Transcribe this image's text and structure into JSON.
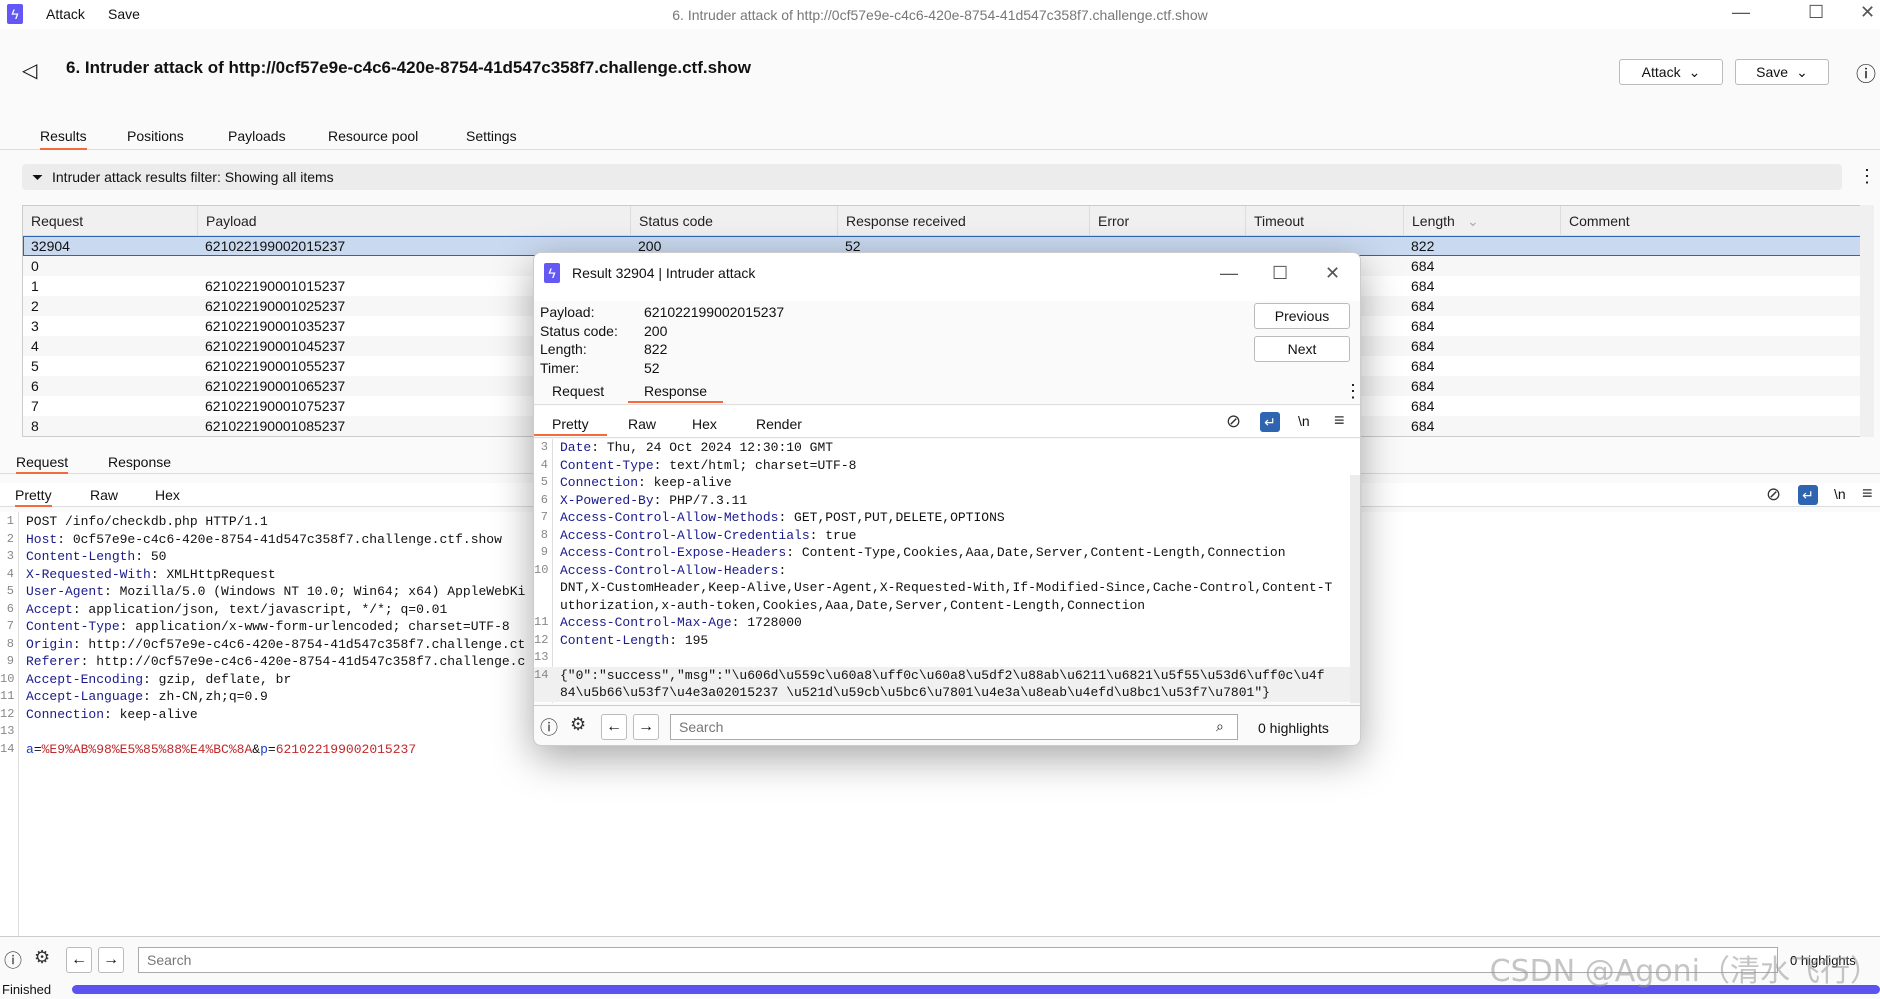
{
  "app": {
    "menu": [
      "Attack",
      "Save"
    ],
    "window_title": "6. Intruder attack of http://0cf57e9e-c4c6-420e-8754-41d547c358f7.challenge.ctf.show",
    "accent": "#6458f5"
  },
  "header": {
    "title": "6. Intruder attack of http://0cf57e9e-c4c6-420e-8754-41d547c358f7.challenge.ctf.show",
    "attack_btn": "Attack",
    "save_btn": "Save"
  },
  "tabs": [
    "Results",
    "Positions",
    "Payloads",
    "Resource pool",
    "Settings"
  ],
  "filter": "Intruder attack results filter: Showing all items",
  "table": {
    "columns": [
      "Request",
      "Payload",
      "Status code",
      "Response received",
      "Error",
      "Timeout",
      "Length",
      "Comment"
    ],
    "rows": [
      [
        "32904",
        "621022199002015237",
        "200",
        "52",
        "",
        "",
        "822",
        ""
      ],
      [
        "0",
        "",
        "",
        "",
        "",
        "",
        "684",
        ""
      ],
      [
        "1",
        "621022190001015237",
        "",
        "",
        "",
        "",
        "684",
        ""
      ],
      [
        "2",
        "621022190001025237",
        "",
        "",
        "",
        "",
        "684",
        ""
      ],
      [
        "3",
        "621022190001035237",
        "",
        "",
        "",
        "",
        "684",
        ""
      ],
      [
        "4",
        "621022190001045237",
        "",
        "",
        "",
        "",
        "684",
        ""
      ],
      [
        "5",
        "621022190001055237",
        "",
        "",
        "",
        "",
        "684",
        ""
      ],
      [
        "6",
        "621022190001065237",
        "",
        "",
        "",
        "",
        "684",
        ""
      ],
      [
        "7",
        "621022190001075237",
        "",
        "",
        "",
        "",
        "684",
        ""
      ],
      [
        "8",
        "621022190001085237",
        "",
        "",
        "",
        "",
        "684",
        ""
      ]
    ]
  },
  "lower": {
    "tabs": [
      "Request",
      "Response"
    ],
    "view_tabs": [
      "Pretty",
      "Raw",
      "Hex"
    ],
    "request_line": "POST /info/checkdb.php HTTP/1.1",
    "headers": [
      [
        "Host",
        "0cf57e9e-c4c6-420e-8754-41d547c358f7.challenge.ctf.show"
      ],
      [
        "Content-Length",
        "50"
      ],
      [
        "X-Requested-With",
        "XMLHttpRequest"
      ],
      [
        "User-Agent",
        "Mozilla/5.0 (Windows NT 10.0; Win64; x64) AppleWebKi"
      ],
      [
        "Accept",
        "application/json, text/javascript, */*; q=0.01"
      ],
      [
        "Content-Type",
        "application/x-www-form-urlencoded; charset=UTF-8"
      ],
      [
        "Origin",
        "http://0cf57e9e-c4c6-420e-8754-41d547c358f7.challenge.ct"
      ],
      [
        "Referer",
        "http://0cf57e9e-c4c6-420e-8754-41d547c358f7.challenge.c"
      ],
      [
        "Accept-Encoding",
        "gzip, deflate, br"
      ],
      [
        "Accept-Language",
        "zh-CN,zh;q=0.9"
      ],
      [
        "Connection",
        "keep-alive"
      ]
    ],
    "body": {
      "k1": "a",
      "v1": "%E9%AB%98%E5%85%88%E4%BC%8A",
      "k2": "p",
      "v2": "621022199002015237"
    },
    "search_placeholder": "Search",
    "highlights": "0 highlights",
    "status": "Finished",
    "progress": 1.0
  },
  "popup": {
    "title": "Result 32904 | Intruder attack",
    "fields": [
      [
        "Payload:",
        "621022199002015237"
      ],
      [
        "Status code:",
        "200"
      ],
      [
        "Length:",
        "822"
      ],
      [
        "Timer:",
        "52"
      ]
    ],
    "previous": "Previous",
    "next": "Next",
    "tabs": [
      "Request",
      "Response"
    ],
    "view_tabs": [
      "Pretty",
      "Raw",
      "Hex",
      "Render"
    ],
    "newline_toggle": "\\n",
    "lines": [
      {
        "n": "3",
        "k": "Date",
        "v": "Thu, 24 Oct 2024 12:30:10 GMT"
      },
      {
        "n": "4",
        "k": "Content-Type",
        "v": "text/html; charset=UTF-8"
      },
      {
        "n": "5",
        "k": "Connection",
        "v": "keep-alive"
      },
      {
        "n": "6",
        "k": "X-Powered-By",
        "v": "PHP/7.3.11"
      },
      {
        "n": "7",
        "k": "Access-Control-Allow-Methods",
        "v": "GET,POST,PUT,DELETE,OPTIONS"
      },
      {
        "n": "8",
        "k": "Access-Control-Allow-Credentials",
        "v": "true"
      },
      {
        "n": "9",
        "k": "Access-Control-Expose-Headers",
        "v": "Content-Type,Cookies,Aaa,Date,Server,Content-Length,Connection"
      },
      {
        "n": "10",
        "k": "Access-Control-Allow-Headers",
        "v": ""
      },
      {
        "n": "",
        "k": "",
        "v": "DNT,X-CustomHeader,Keep-Alive,User-Agent,X-Requested-With,If-Modified-Since,Cache-Control,Content-T"
      },
      {
        "n": "",
        "k": "",
        "v": "uthorization,x-auth-token,Cookies,Aaa,Date,Server,Content-Length,Connection"
      },
      {
        "n": "11",
        "k": "Access-Control-Max-Age",
        "v": "1728000"
      },
      {
        "n": "12",
        "k": "Content-Length",
        "v": "195"
      },
      {
        "n": "13",
        "k": "",
        "v": ""
      },
      {
        "n": "14",
        "k": "",
        "v": "{\"0\":\"success\",\"msg\":\"\\u606d\\u559c\\u60a8\\uff0c\\u60a8\\u5df2\\u88ab\\u6211\\u6821\\u5f55\\u53d6\\uff0c\\u4f"
      },
      {
        "n": "",
        "k": "",
        "v": "84\\u5b66\\u53f7\\u4e3a02015237 \\u521d\\u59cb\\u5bc6\\u7801\\u4e3a\\u8eab\\u4efd\\u8bc1\\u53f7\\u7801\"}"
      }
    ],
    "search_placeholder": "Search",
    "highlights": "0 highlights"
  },
  "watermark": "CSDN @Agoni（清水飞行）"
}
